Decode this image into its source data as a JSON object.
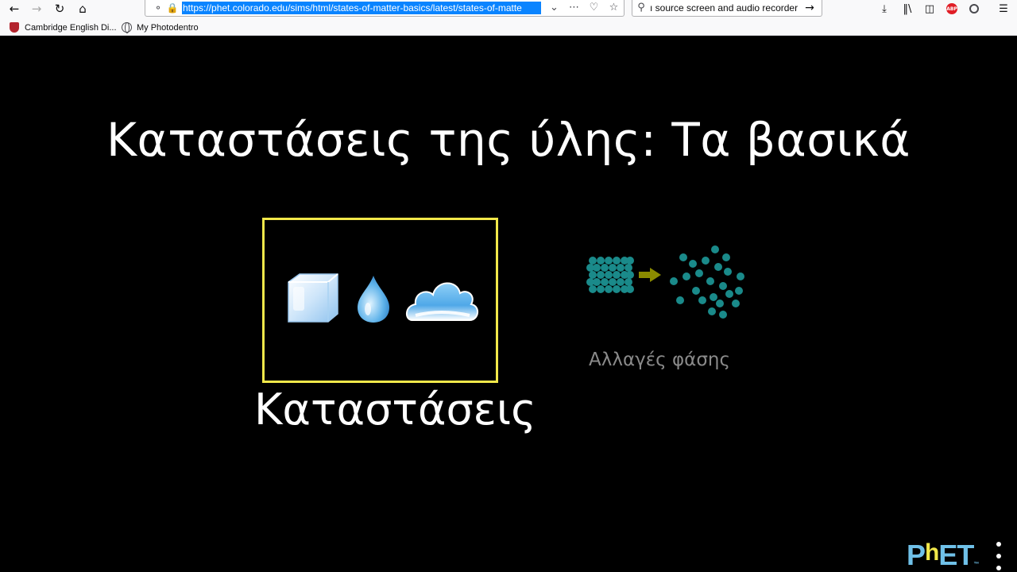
{
  "browser": {
    "url": "https://phet.colorado.edu/sims/html/states-of-matter-basics/latest/states-of-matte",
    "search_text": "ı source screen and audio recorder",
    "icons": {
      "back": "back-arrow-icon",
      "forward": "forward-arrow-icon",
      "reload": "reload-icon",
      "home": "home-icon",
      "tracking": "shield-icon",
      "lock": "lock-icon",
      "dropdown": "chevron-down-icon",
      "page_actions": "more-dots-icon",
      "pocket": "pocket-icon",
      "bookmark": "star-icon",
      "search": "search-icon",
      "search_go": "arrow-right-icon",
      "downloads": "download-icon",
      "library": "library-icon",
      "sidebar": "sidebar-icon",
      "adblock": "abp-icon",
      "account": "account-icon",
      "menu": "hamburger-menu-icon"
    },
    "adblock_label": "ABP"
  },
  "bookmarks": [
    {
      "label": "Cambridge English Di...",
      "icon": "cambridge-shield-icon"
    },
    {
      "label": "My Photodentro",
      "icon": "globe-icon"
    }
  ],
  "sim": {
    "title": "Καταστάσεις της ύλης: Τα βασικά",
    "screens": [
      {
        "label": "Καταστάσεις",
        "selected": true,
        "icons": [
          "ice-cube-icon",
          "water-drop-icon",
          "cloud-icon"
        ]
      },
      {
        "label": "Αλλαγές φάσης",
        "selected": false,
        "icons": [
          "phase-change-molecules-icon"
        ]
      }
    ],
    "colors": {
      "selected_border": "#f2e84a",
      "molecule": "#1a8a8a",
      "arrow": "#8a8a00",
      "logo_blue": "#6fc0e8",
      "logo_yellow": "#f2e84a"
    },
    "logo": {
      "p": "P",
      "h": "h",
      "e": "E",
      "t": "T",
      "tm": "™"
    }
  }
}
